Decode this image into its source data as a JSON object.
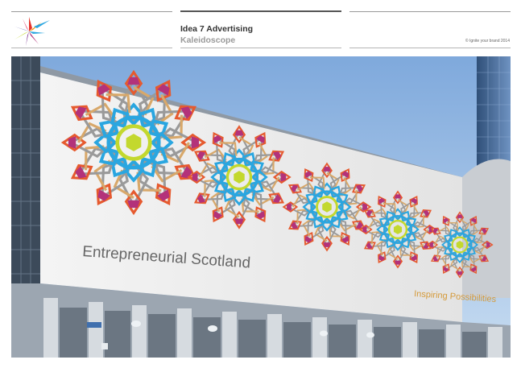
{
  "header": {
    "title": "Idea 7 Advertising",
    "subtitle": "Kaleidoscope",
    "copyright": "© Ignite your brand 2014"
  },
  "billboard": {
    "headline": "Entrepreneurial Scotland",
    "tagline": "Inspiring Possibilities"
  },
  "colors": {
    "tagline": "#d59a3a",
    "headline": "#666666",
    "sky": "#9ec0e6",
    "rosette_palette": [
      "#2aa6e0",
      "#c3d82e",
      "#b3327a",
      "#e65a2e",
      "#d8a86a",
      "#9a9a9a"
    ]
  },
  "icons": [
    "kaleidoscope-logo-icon"
  ]
}
